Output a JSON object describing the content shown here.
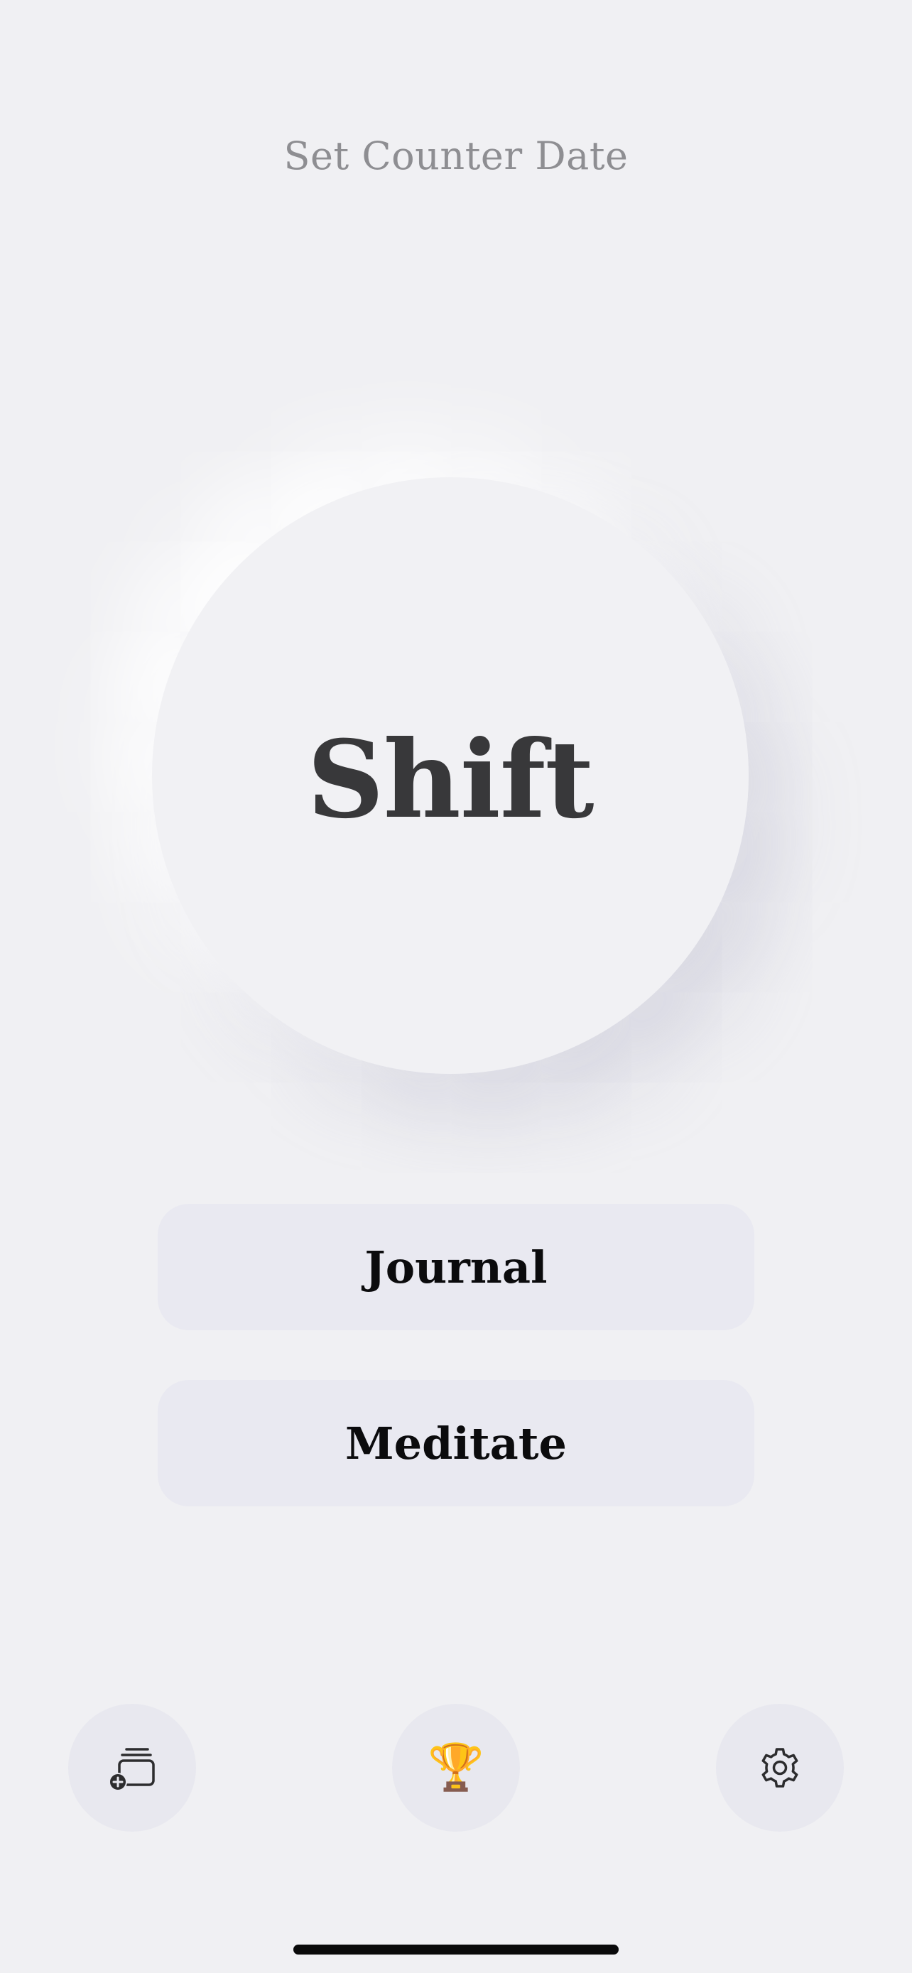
{
  "header": {
    "set_counter_label": "Set Counter Date"
  },
  "main": {
    "shift_label": "Shift"
  },
  "actions": {
    "journal_label": "Journal",
    "meditate_label": "Meditate"
  },
  "bottom_bar": {
    "new_entry_icon": "stack-add-icon",
    "trophy_icon": "trophy-icon",
    "trophy_glyph": "🏆",
    "settings_icon": "gear-icon"
  },
  "colors": {
    "background": "#f0f0f3",
    "button_bg": "#e9e9f1",
    "text_primary": "#0b0b0d",
    "text_secondary": "#8e8e92"
  }
}
